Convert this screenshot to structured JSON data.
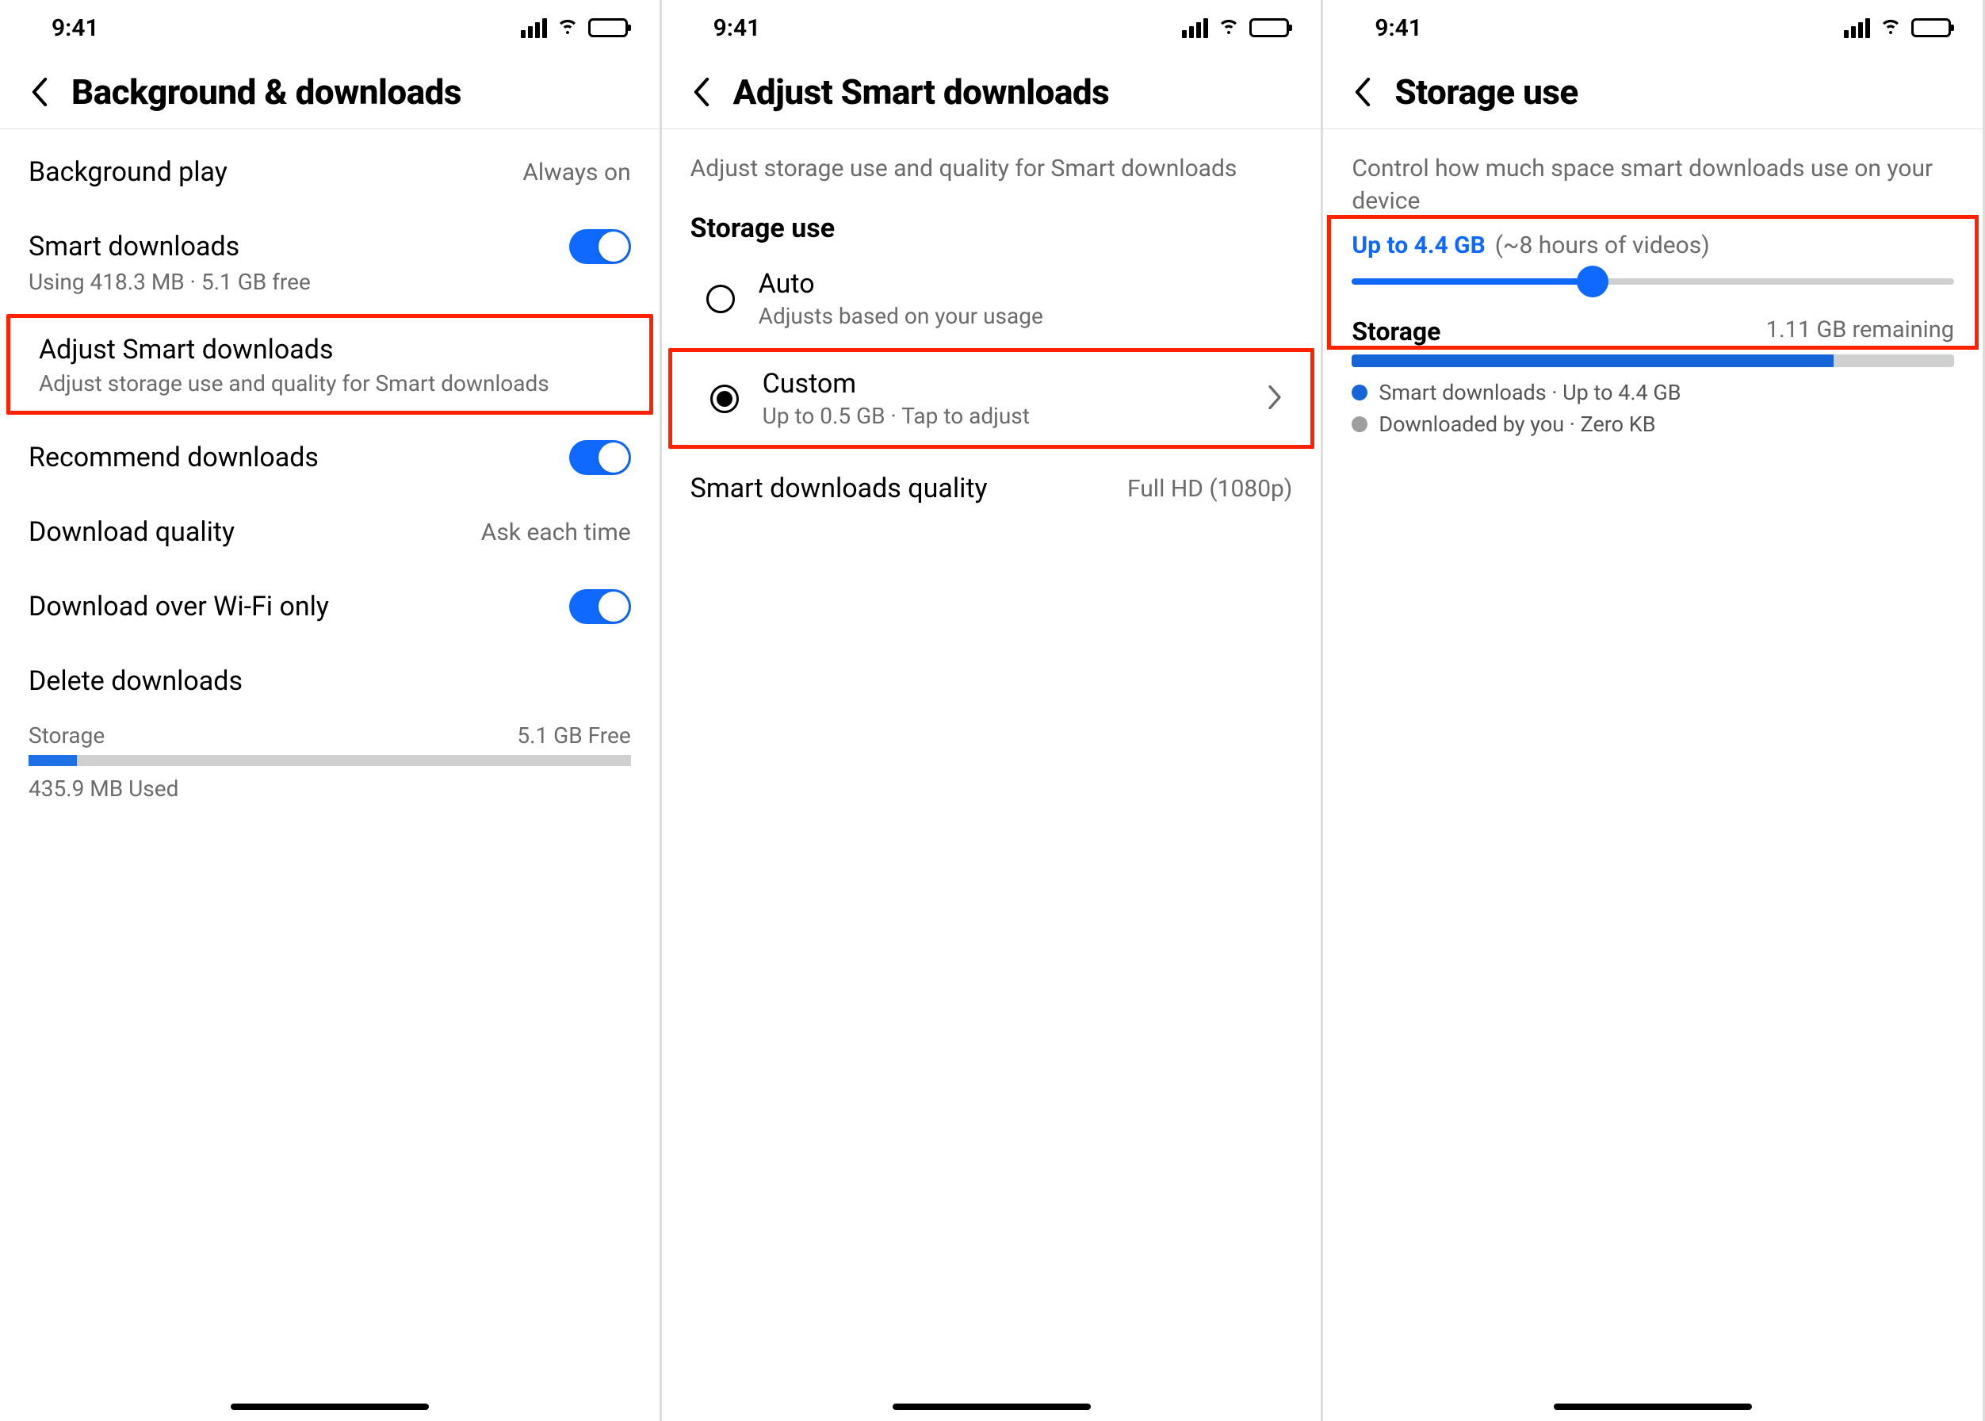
{
  "status": {
    "time": "9:41"
  },
  "screen1": {
    "title": "Background & downloads",
    "rows": {
      "background_play": {
        "label": "Background play",
        "value": "Always on"
      },
      "smart_downloads": {
        "label": "Smart downloads",
        "sub": "Using 418.3 MB · 5.1 GB free"
      },
      "adjust": {
        "label": "Adjust Smart downloads",
        "sub": "Adjust storage use and quality for Smart downloads"
      },
      "recommend": {
        "label": "Recommend downloads"
      },
      "quality": {
        "label": "Download quality",
        "value": "Ask each time"
      },
      "wifi": {
        "label": "Download over Wi-Fi only"
      },
      "delete": {
        "label": "Delete downloads"
      }
    },
    "storage": {
      "label": "Storage",
      "free": "5.1 GB Free",
      "used": "435.9 MB Used",
      "fill_pct": 8
    }
  },
  "screen2": {
    "title": "Adjust Smart downloads",
    "intro": "Adjust storage use and quality for Smart downloads",
    "section": "Storage use",
    "auto": {
      "title": "Auto",
      "sub": "Adjusts based on your usage"
    },
    "custom": {
      "title": "Custom",
      "sub": "Up to 0.5 GB · Tap to adjust"
    },
    "quality": {
      "label": "Smart downloads quality",
      "value": "Full HD (1080p)"
    }
  },
  "screen3": {
    "title": "Storage use",
    "desc": "Control how much space smart downloads use on your device",
    "upto_prefix": "Up to 4.4 GB",
    "upto_paren": "(~8 hours of videos)",
    "slider_pct": 40,
    "storage_label": "Storage",
    "remaining": "1.11 GB remaining",
    "bar_fill_pct": 80,
    "legend1": "Smart downloads · Up to 4.4 GB",
    "legend2": "Downloaded by you · Zero KB"
  }
}
